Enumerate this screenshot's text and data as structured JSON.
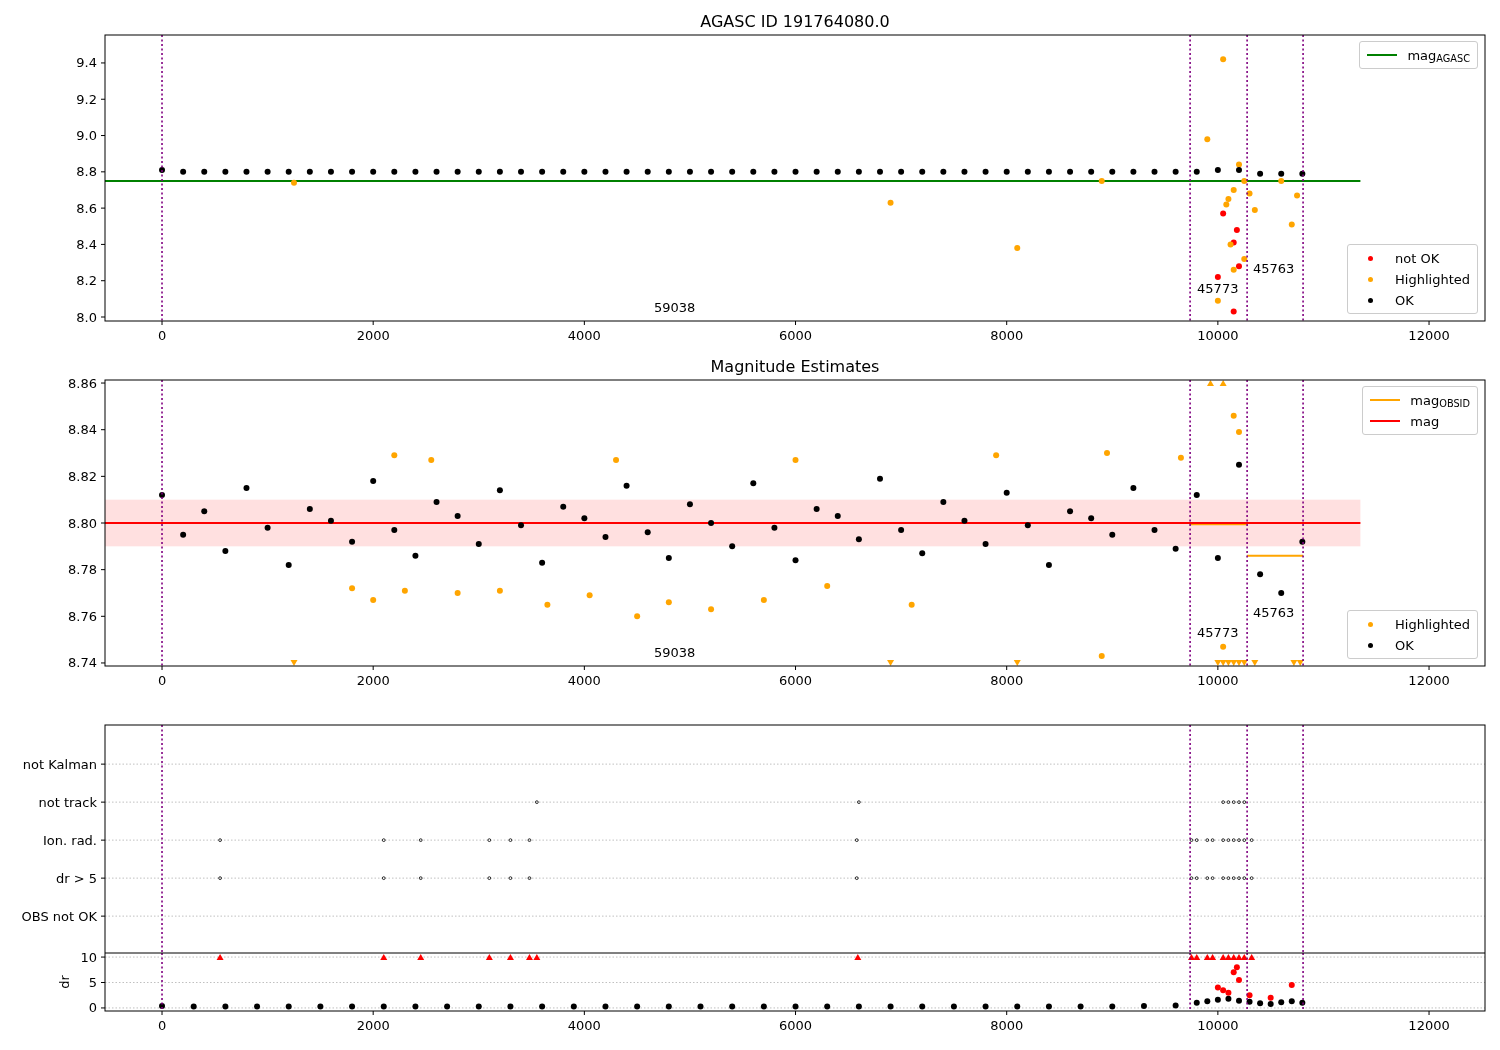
{
  "figure": {
    "panels": [
      {
        "title": "AGASC ID 191764080.0",
        "chart_data": {
          "type": "scatter",
          "xlim": [
            -540,
            12530
          ],
          "ylim": [
            7.978,
            9.554
          ],
          "xticks": [
            0,
            2000,
            4000,
            6000,
            8000,
            10000,
            12000
          ],
          "yticks": [
            {
              "value": 8.0,
              "label": "8.0"
            },
            {
              "value": 8.2,
              "label": "8.2"
            },
            {
              "value": 8.4,
              "label": "8.4"
            },
            {
              "value": 8.6,
              "label": "8.6"
            },
            {
              "value": 8.8,
              "label": "8.8"
            },
            {
              "value": 9.0,
              "label": "9.0"
            },
            {
              "value": 9.2,
              "label": "9.2"
            },
            {
              "value": 9.4,
              "label": "9.4"
            }
          ],
          "series": [
            {
              "type": "line",
              "color": "#008000",
              "x": [
                -540,
                11350
              ],
              "values": [
                8.75,
                8.75
              ]
            },
            {
              "marker": "circle",
              "color": "#ff0000",
              "x": [
                10050,
                10150,
                10180,
                10200,
                10150,
                10000
              ],
              "values": [
                8.57,
                8.41,
                8.48,
                8.28,
                8.03,
                8.22
              ]
            },
            {
              "marker": "circle",
              "color": "#ffa500",
              "x": [
                1250,
                6900,
                8100,
                8900,
                9900,
                10050,
                10000,
                10100,
                10150,
                10200,
                10250,
                10300,
                10350,
                10600,
                10700,
                10750,
                10150,
                10120,
                10250,
                10080
              ],
              "values": [
                8.74,
                8.63,
                8.38,
                8.75,
                8.98,
                9.42,
                8.09,
                8.65,
                8.7,
                8.84,
                8.75,
                8.68,
                8.59,
                8.75,
                8.51,
                8.67,
                8.26,
                8.4,
                8.32,
                8.62
              ]
            },
            {
              "marker": "circle",
              "color": "#000000",
              "x": [
                0,
                200,
                400,
                600,
                800,
                1000,
                1200,
                1400,
                1600,
                1800,
                2000,
                2200,
                2400,
                2600,
                2800,
                3000,
                3200,
                3400,
                3600,
                3800,
                4000,
                4200,
                4400,
                4600,
                4800,
                5000,
                5200,
                5400,
                5600,
                5800,
                6000,
                6200,
                6400,
                6600,
                6800,
                7000,
                7200,
                7400,
                7600,
                7800,
                8000,
                8200,
                8400,
                8600,
                8800,
                9000,
                9200,
                9400,
                9600,
                9800,
                10000,
                10200,
                10400,
                10600,
                10800
              ],
              "values": [
                8.81,
                8.8,
                8.8,
                8.8,
                8.8,
                8.8,
                8.8,
                8.8,
                8.8,
                8.8,
                8.8,
                8.8,
                8.8,
                8.8,
                8.8,
                8.8,
                8.8,
                8.8,
                8.8,
                8.8,
                8.8,
                8.8,
                8.8,
                8.8,
                8.8,
                8.8,
                8.8,
                8.8,
                8.8,
                8.8,
                8.8,
                8.8,
                8.8,
                8.8,
                8.8,
                8.8,
                8.8,
                8.8,
                8.8,
                8.8,
                8.8,
                8.8,
                8.8,
                8.8,
                8.8,
                8.8,
                8.8,
                8.8,
                8.8,
                8.8,
                8.81,
                8.81,
                8.79,
                8.79,
                8.79
              ]
            }
          ],
          "ref_lines": [
            {
              "axis": "x",
              "value": 0,
              "color": "#800080"
            },
            {
              "axis": "x",
              "value": 9737,
              "color": "#800080"
            },
            {
              "axis": "x",
              "value": 10277,
              "color": "#800080"
            },
            {
              "axis": "x",
              "value": 10807,
              "color": "#800080"
            }
          ],
          "annotations": [
            "59038",
            "45773",
            "45763"
          ]
        },
        "legends": [
          {
            "entries": [
              {
                "label": "mag$_{AGASC}$",
                "kind": "line",
                "color": "#008000"
              }
            ]
          },
          {
            "entries": [
              {
                "label": "not OK",
                "kind": "point",
                "color": "#ff0000"
              },
              {
                "label": "Highlighted",
                "kind": "point",
                "color": "#ffa500"
              },
              {
                "label": "OK",
                "kind": "point",
                "color": "#000000"
              }
            ]
          }
        ]
      },
      {
        "title": "Magnitude Estimates",
        "chart_data": {
          "type": "scatter",
          "xlim": [
            -540,
            12530
          ],
          "ylim": [
            8.7387,
            8.8613
          ],
          "xticks": [
            0,
            2000,
            4000,
            6000,
            8000,
            10000,
            12000
          ],
          "yticks": [
            {
              "value": 8.74,
              "label": "8.74"
            },
            {
              "value": 8.76,
              "label": "8.76"
            },
            {
              "value": 8.78,
              "label": "8.78"
            },
            {
              "value": 8.8,
              "label": "8.80"
            },
            {
              "value": 8.82,
              "label": "8.82"
            },
            {
              "value": 8.84,
              "label": "8.84"
            },
            {
              "value": 8.86,
              "label": "8.86"
            }
          ],
          "series": [
            {
              "type": "line",
              "color": "#ffa500",
              "x": [
                9737,
                10277,
                null,
                10277,
                10807
              ],
              "values": [
                8.7995,
                8.7995,
                null,
                8.786,
                8.786
              ]
            },
            {
              "type": "line",
              "color": "#ff0000",
              "x": [
                -540,
                11350
              ],
              "values": [
                8.8,
                8.8
              ]
            },
            {
              "marker": "circle",
              "color": "#ffa500",
              "x": [
                1800,
                2000,
                2200,
                2300,
                2550,
                2800,
                3200,
                3650,
                4050,
                4300,
                4500,
                4800,
                5200,
                5700,
                6000,
                6300,
                7100,
                7900,
                8900,
                8950,
                9650,
                10150,
                10200,
                10050
              ],
              "values": [
                8.772,
                8.767,
                8.829,
                8.771,
                8.827,
                8.77,
                8.771,
                8.765,
                8.769,
                8.827,
                8.76,
                8.766,
                8.763,
                8.767,
                8.827,
                8.773,
                8.765,
                8.829,
                8.743,
                8.83,
                8.828,
                8.846,
                8.839,
                8.747
              ]
            },
            {
              "marker": "triangle",
              "color": "#ffa500",
              "x": [
                1250,
                6900,
                8100,
                10000,
                10050,
                10100,
                10150,
                10200,
                10250,
                10350,
                10720,
                10780
              ],
              "values": [
                8.74,
                8.74,
                8.74,
                8.74,
                8.74,
                8.74,
                8.74,
                8.74,
                8.74,
                8.74,
                8.74,
                8.74
              ]
            },
            {
              "marker": "triangle",
              "color": "#ffa500",
              "x": [
                9930,
                10050
              ],
              "values": [
                8.86,
                8.86
              ]
            },
            {
              "marker": "circle",
              "color": "#000000",
              "x": [
                0,
                200,
                400,
                600,
                800,
                1000,
                1200,
                1400,
                1600,
                1800,
                2000,
                2200,
                2400,
                2600,
                2800,
                3000,
                3200,
                3400,
                3600,
                3800,
                4000,
                4200,
                4400,
                4600,
                4800,
                5000,
                5200,
                5400,
                5600,
                5800,
                6000,
                6200,
                6400,
                6600,
                6800,
                7000,
                7200,
                7400,
                7600,
                7800,
                8000,
                8200,
                8400,
                8600,
                8800,
                9000,
                9200,
                9400,
                9600,
                9800,
                10000,
                10200,
                10400,
                10600,
                10800
              ],
              "values": [
                8.812,
                8.795,
                8.805,
                8.788,
                8.815,
                8.798,
                8.782,
                8.806,
                8.801,
                8.792,
                8.818,
                8.797,
                8.786,
                8.809,
                8.803,
                8.791,
                8.814,
                8.799,
                8.783,
                8.807,
                8.802,
                8.794,
                8.816,
                8.796,
                8.785,
                8.808,
                8.8,
                8.79,
                8.817,
                8.798,
                8.784,
                8.806,
                8.803,
                8.793,
                8.819,
                8.797,
                8.787,
                8.809,
                8.801,
                8.791,
                8.813,
                8.799,
                8.782,
                8.805,
                8.802,
                8.795,
                8.815,
                8.797,
                8.789,
                8.812,
                8.785,
                8.825,
                8.778,
                8.77,
                8.792
              ]
            }
          ],
          "bands": [
            {
              "axis": "y",
              "from": 8.79,
              "to": 8.81,
              "color": "#ff0000"
            }
          ],
          "ref_lines": [
            {
              "axis": "x",
              "value": 0,
              "color": "#800080"
            },
            {
              "axis": "x",
              "value": 9737,
              "color": "#800080"
            },
            {
              "axis": "x",
              "value": 10277,
              "color": "#800080"
            },
            {
              "axis": "x",
              "value": 10807,
              "color": "#800080"
            }
          ],
          "annotations": [
            "59038",
            "45773",
            "45763"
          ]
        },
        "legends": [
          {
            "entries": [
              {
                "label": "mag$_{OBSID}$",
                "kind": "line",
                "color": "#ffa500"
              },
              {
                "label": "mag",
                "kind": "line",
                "color": "#ff0000"
              }
            ]
          },
          {
            "entries": [
              {
                "label": "Highlighted",
                "kind": "point",
                "color": "#ffa500"
              },
              {
                "label": "OK",
                "kind": "point",
                "color": "#000000"
              }
            ]
          }
        ]
      },
      {
        "flags": {
          "row_labels": [
            "not Kalman",
            "not track",
            "Ion. rad.",
            "dr > 5",
            "OBS not OK"
          ]
        }
      },
      {
        "chart_data": {
          "type": "scatter",
          "ylabel": "dr",
          "grid": true,
          "xlim": [
            -540,
            12530
          ],
          "ylim": [
            -0.6,
            10.8
          ],
          "xticks": [
            0,
            2000,
            4000,
            6000,
            8000,
            10000,
            12000
          ],
          "yticks": [
            0,
            5,
            10
          ],
          "series": [
            {
              "marker": "circle",
              "color": "#000000",
              "x": [
                0,
                300,
                600,
                900,
                1200,
                1500,
                1800,
                2100,
                2400,
                2700,
                3000,
                3300,
                3600,
                3900,
                4200,
                4500,
                4800,
                5100,
                5400,
                5700,
                6000,
                6300,
                6600,
                6900,
                7200,
                7500,
                7800,
                8100,
                8400,
                8700,
                9000,
                9300,
                9600,
                9800,
                9900,
                10000,
                10100,
                10200,
                10300,
                10400,
                10500,
                10600,
                10700,
                10800
              ],
              "values": [
                0.4,
                0.3,
                0.3,
                0.3,
                0.3,
                0.3,
                0.3,
                0.3,
                0.3,
                0.3,
                0.3,
                0.3,
                0.3,
                0.3,
                0.3,
                0.3,
                0.3,
                0.3,
                0.3,
                0.3,
                0.3,
                0.3,
                0.3,
                0.3,
                0.3,
                0.3,
                0.3,
                0.3,
                0.3,
                0.3,
                0.3,
                0.4,
                0.5,
                1.0,
                1.3,
                1.6,
                1.8,
                1.4,
                1.2,
                0.9,
                0.8,
                1.1,
                1.3,
                1.0
              ]
            },
            {
              "marker": "triangle",
              "color": "#ff0000",
              "x": [
                550,
                2100,
                2450,
                3100,
                3300,
                3480,
                3550,
                6590,
                9750,
                9800,
                9900,
                9950,
                10050,
                10100,
                10150,
                10200,
                10250,
                10320
              ],
              "values": [
                10,
                10,
                10,
                10,
                10,
                10,
                10,
                10,
                10,
                10,
                10,
                10,
                10,
                10,
                10,
                10,
                10,
                10
              ]
            },
            {
              "marker": "circle",
              "color": "#ff0000",
              "x": [
                10000,
                10100,
                10150,
                10180,
                10200,
                10050,
                10300,
                10500,
                10700
              ],
              "values": [
                4,
                3,
                7,
                8,
                5.5,
                3.5,
                2.5,
                2,
                4.5
              ]
            }
          ],
          "ref_lines": [
            {
              "axis": "x",
              "value": 0,
              "color": "#800080"
            },
            {
              "axis": "x",
              "value": 9737,
              "color": "#800080"
            },
            {
              "axis": "x",
              "value": 10277,
              "color": "#800080"
            },
            {
              "axis": "x",
              "value": 10807,
              "color": "#800080"
            }
          ]
        }
      }
    ]
  }
}
